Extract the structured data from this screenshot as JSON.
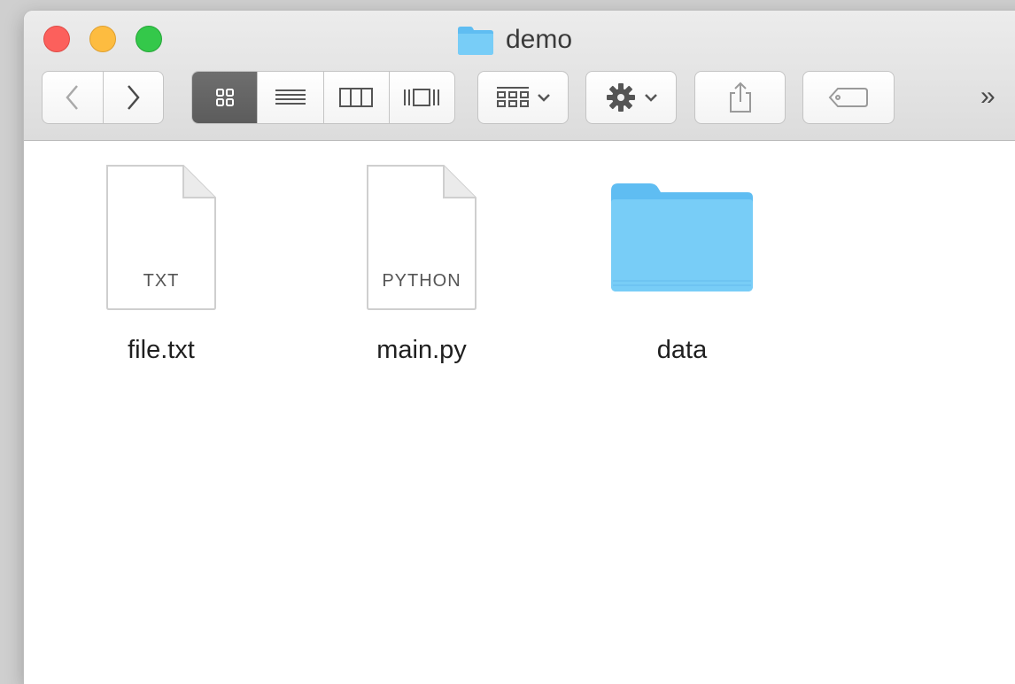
{
  "window": {
    "title": "demo"
  },
  "toolbar": {
    "back_icon": "chevron-left-icon",
    "forward_icon": "chevron-right-icon",
    "view_modes": [
      {
        "icon": "icon-view-icon",
        "active": true
      },
      {
        "icon": "list-view-icon",
        "active": false
      },
      {
        "icon": "column-view-icon",
        "active": false
      },
      {
        "icon": "cover-flow-icon",
        "active": false
      }
    ],
    "arrange_icon": "arrange-grid-icon",
    "action_icon": "gear-icon",
    "share_icon": "share-icon",
    "tags_icon": "tag-icon",
    "overflow": "»"
  },
  "files": [
    {
      "name": "file.txt",
      "kind": "document",
      "badge": "TXT"
    },
    {
      "name": "main.py",
      "kind": "document",
      "badge": "PYTHON"
    },
    {
      "name": "data",
      "kind": "folder",
      "badge": ""
    }
  ],
  "colors": {
    "close": "#fc605c",
    "minimize": "#fdbc40",
    "zoom": "#34c84a",
    "folder": "#6cc4f5",
    "active_segment": "#636363"
  }
}
